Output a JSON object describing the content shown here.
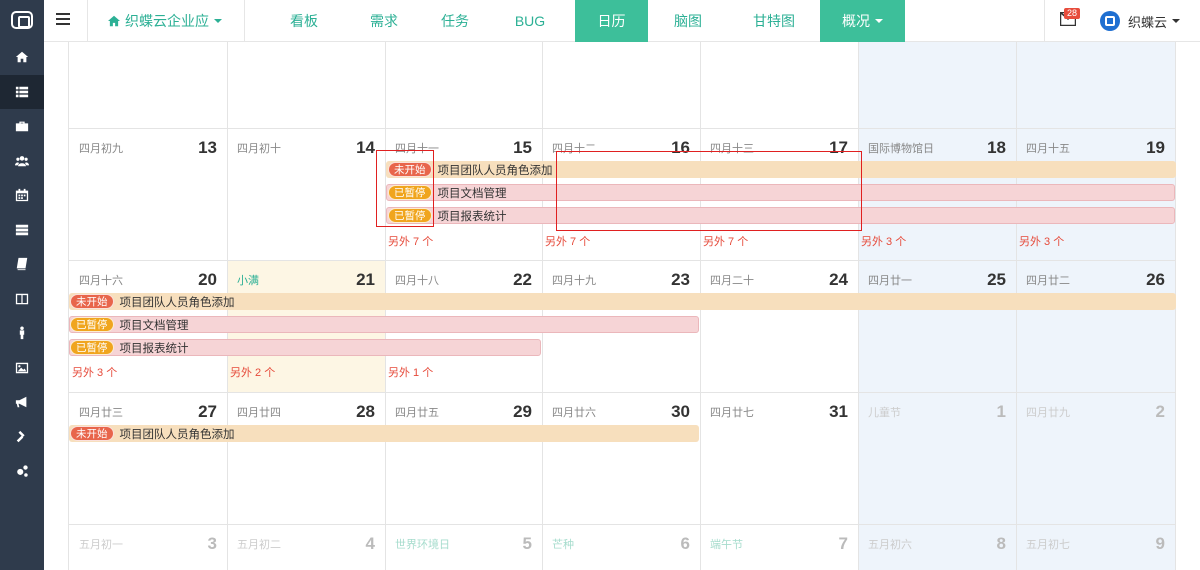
{
  "sidebar": {
    "items": [
      {
        "name": "home-icon"
      },
      {
        "name": "list-icon"
      },
      {
        "name": "briefcase-icon"
      },
      {
        "name": "users-icon"
      },
      {
        "name": "calendar-icon"
      },
      {
        "name": "server-icon"
      },
      {
        "name": "book-icon"
      },
      {
        "name": "columns-icon"
      },
      {
        "name": "person-icon"
      },
      {
        "name": "image-icon"
      },
      {
        "name": "bullhorn-icon"
      },
      {
        "name": "gavel-icon"
      },
      {
        "name": "cogs-icon"
      }
    ]
  },
  "header": {
    "company": "织蝶云企业应",
    "nav": [
      "看板",
      "需求",
      "任务",
      "BUG",
      "日历",
      "脑图",
      "甘特图",
      "概况"
    ],
    "active_nav": "日历",
    "mail_count": "28",
    "user_name": "织蝶云"
  },
  "calendar": {
    "weeks": [
      {
        "days": []
      },
      {
        "days": [
          {
            "lunar": "四月初九",
            "num": "13"
          },
          {
            "lunar": "四月初十",
            "num": "14"
          },
          {
            "lunar": "四月十一",
            "num": "15"
          },
          {
            "lunar": "四月十二",
            "num": "16"
          },
          {
            "lunar": "四月十三",
            "num": "17"
          },
          {
            "lunar": "国际博物馆日",
            "num": "18"
          },
          {
            "lunar": "四月十五",
            "num": "19"
          }
        ]
      },
      {
        "days": [
          {
            "lunar": "四月十六",
            "num": "20"
          },
          {
            "lunar": "小满",
            "num": "21"
          },
          {
            "lunar": "四月十八",
            "num": "22"
          },
          {
            "lunar": "四月十九",
            "num": "23"
          },
          {
            "lunar": "四月二十",
            "num": "24"
          },
          {
            "lunar": "四月廿一",
            "num": "25"
          },
          {
            "lunar": "四月廿二",
            "num": "26"
          }
        ]
      },
      {
        "days": [
          {
            "lunar": "四月廿三",
            "num": "27"
          },
          {
            "lunar": "四月廿四",
            "num": "28"
          },
          {
            "lunar": "四月廿五",
            "num": "29"
          },
          {
            "lunar": "四月廿六",
            "num": "30"
          },
          {
            "lunar": "四月廿七",
            "num": "31"
          },
          {
            "lunar": "儿童节",
            "num": "1"
          },
          {
            "lunar": "四月廿九",
            "num": "2"
          }
        ]
      },
      {
        "days": [
          {
            "lunar": "五月初一",
            "num": "3"
          },
          {
            "lunar": "五月初二",
            "num": "4"
          },
          {
            "lunar": "世界环境日",
            "num": "5"
          },
          {
            "lunar": "芒种",
            "num": "6"
          },
          {
            "lunar": "端午节",
            "num": "7"
          },
          {
            "lunar": "五月初六",
            "num": "8"
          },
          {
            "lunar": "五月初七",
            "num": "9"
          }
        ]
      }
    ],
    "status": {
      "not_started": "未开始",
      "paused": "已暂停"
    },
    "events": {
      "role_add": "项目团队人员角色添加",
      "doc_mgmt": "项目文档管理",
      "report": "项目报表统计"
    },
    "more": {
      "w2": [
        "另外 7 个",
        "另外 7 个",
        "另外 7 个",
        "另外 3 个",
        "另外 3 个"
      ],
      "w3": [
        "另外 3 个",
        "另外 2 个",
        "另外 1 个"
      ]
    }
  }
}
